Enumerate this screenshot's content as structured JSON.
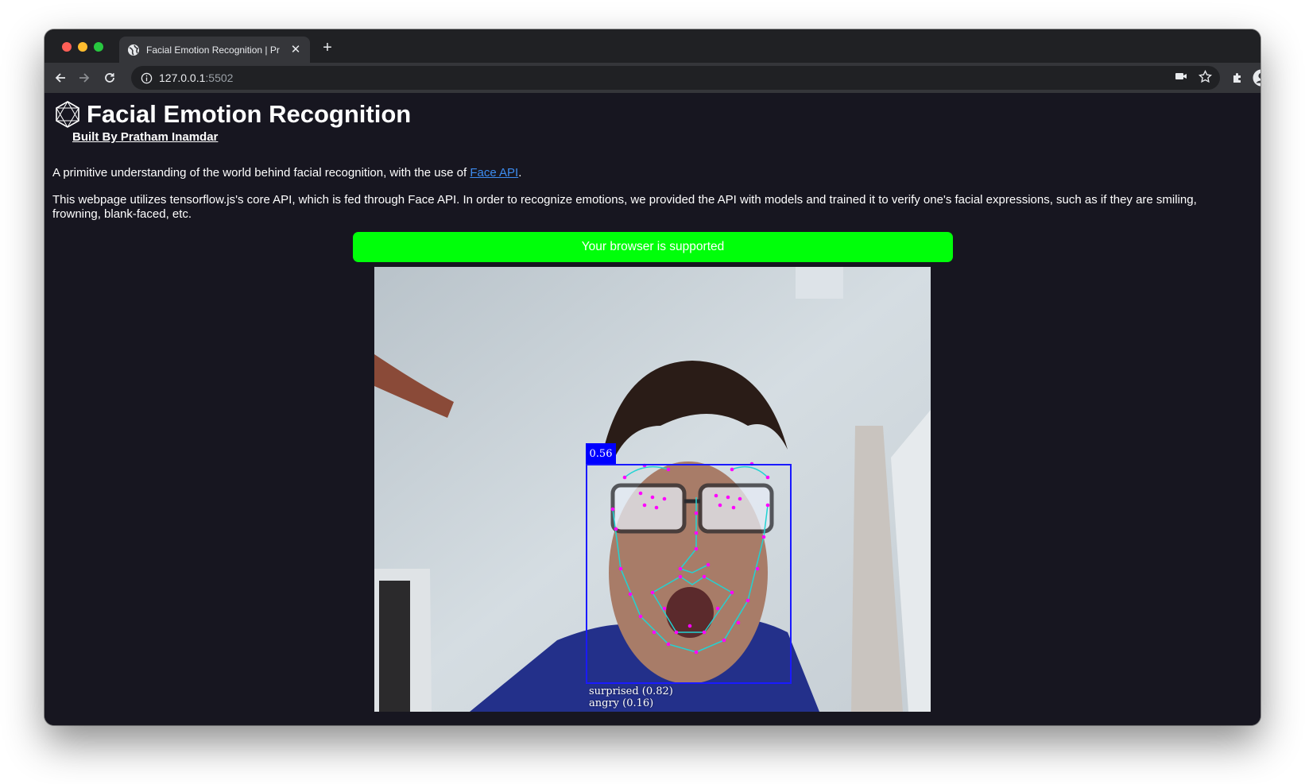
{
  "browser": {
    "tab_title": "Facial Emotion Recognition | Pr",
    "url_host": "127.0.0.1",
    "url_port": ":5502",
    "icons": {
      "back": "back-arrow-icon",
      "forward": "forward-arrow-icon",
      "reload": "reload-icon",
      "info": "info-icon",
      "camera": "camera-icon",
      "bookmark": "star-icon",
      "extensions": "puzzle-icon",
      "profile": "account-icon",
      "menu": "kebab-menu-icon"
    }
  },
  "page": {
    "title": "Facial Emotion Recognition",
    "byline": "Built By Pratham Inamdar",
    "intro_text": "A primitive understanding of the world behind facial recognition, with the use of ",
    "intro_link": "Face API",
    "intro_end": ".",
    "description": "This webpage utilizes tensorflow.js's core API, which is fed through Face API. In order to recognize emotions, we provided the API with models and trained it to verify one's facial expressions, such as if they are smiling, frowning, blank-faced, etc.",
    "support_status": "Your browser is supported",
    "support_color": "#00ff0a"
  },
  "detection": {
    "score": "0.56",
    "expression_1": "surprised (0.82)",
    "expression_2": "angry (0.16)",
    "box_color": "#1a1aff",
    "landmark_color": "#ff00ff",
    "jaw_line_color": "#22d3d3"
  }
}
